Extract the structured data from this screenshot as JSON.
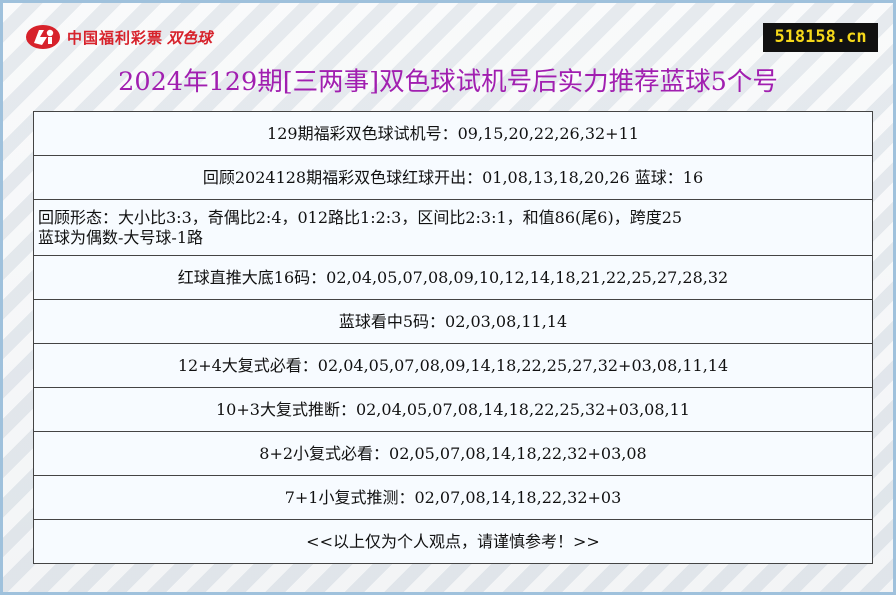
{
  "header": {
    "logo_text": "中国福利彩票",
    "logo_brand": "双色球",
    "site_badge": "518158.cn"
  },
  "title": "2024年129期[三两事]双色球试机号后实力推荐蓝球5个号",
  "rows": [
    "129期福彩双色球试机号：09,15,20,22,26,32+11",
    "回顾2024128期福彩双色球红球开出：01,08,13,18,20,26 蓝球：16",
    "回顾形态：大小比3:3，奇偶比2:4，012路比1:2:3，区间比2:3:1，和值86(尾6)，跨度25",
    "蓝球为偶数-大号球-1路",
    "红球直推大底16码：02,04,05,07,08,09,10,12,14,18,21,22,25,27,28,32",
    "蓝球看中5码：02,03,08,11,14",
    "12+4大复式必看：02,04,05,07,08,09,14,18,22,25,27,32+03,08,11,14",
    "10+3大复式推断：02,04,05,07,08,14,18,22,25,32+03,08,11",
    "8+2小复式必看：02,05,07,08,14,18,22,32+03,08",
    "7+1小复式推测：02,07,08,14,18,22,32+03",
    "<<以上仅为个人观点，请谨慎参考！>>"
  ],
  "colors": {
    "title": "#a11fb0",
    "logo": "#d7222b",
    "badge_bg": "#111111",
    "badge_text": "#f5d81a",
    "frame_border": "#9fc1dc"
  }
}
